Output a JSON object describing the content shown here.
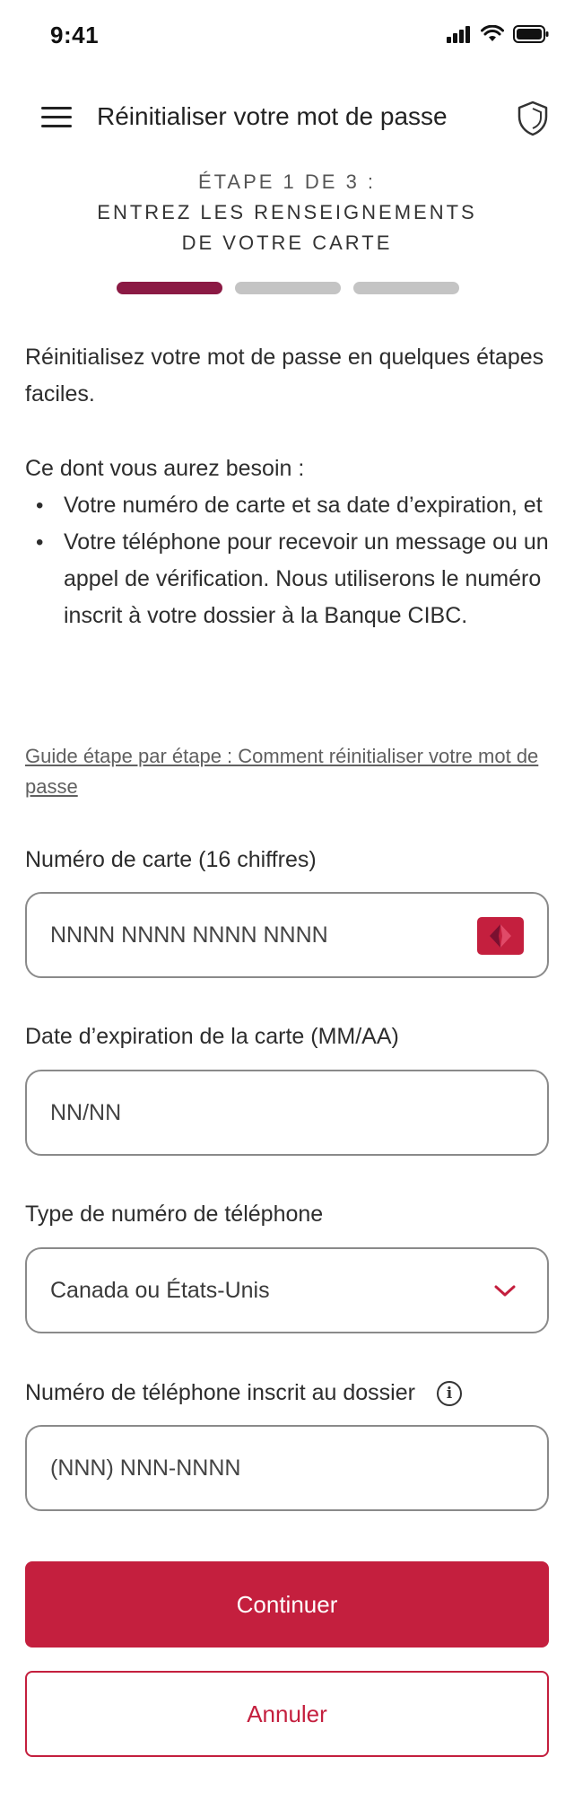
{
  "status_bar": {
    "time": "9:41"
  },
  "header": {
    "title": "Réinitialiser votre mot de passe"
  },
  "step": {
    "line1": "ÉTAPE 1 DE 3 :",
    "line2": "ENTREZ LES RENSEIGNEMENTS",
    "line3": "DE VOTRE CARTE",
    "current": 1,
    "total": 3
  },
  "intro": "Réinitialisez votre mot de passe en quelques étapes faciles.",
  "needs": {
    "title": "Ce dont vous aurez besoin :",
    "items": [
      "Votre numéro de carte et sa date d’expiration, et",
      "Votre téléphone pour recevoir un message ou un appel de vérification. Nous utiliserons le numéro inscrit à votre dossier à la Banque CIBC."
    ]
  },
  "guide_link": "Guide étape par étape : Comment réinitialiser votre mot de passe",
  "form": {
    "card_number": {
      "label": "Numéro de carte (16 chiffres)",
      "placeholder": "NNNN NNNN NNNN NNNN",
      "value": ""
    },
    "expiry": {
      "label": "Date d’expiration de la carte (MM/AA)",
      "placeholder": "NN/NN",
      "value": ""
    },
    "phone_type": {
      "label": "Type de numéro de téléphone",
      "selected": "Canada ou États-Unis"
    },
    "phone_number": {
      "label": "Numéro de téléphone inscrit au dossier",
      "placeholder": "(NNN) NNN-NNNN",
      "value": ""
    }
  },
  "buttons": {
    "continue": "Continuer",
    "cancel": "Annuler"
  },
  "colors": {
    "brand_red": "#c41f3e",
    "progress_active": "#8b1a44",
    "progress_inactive": "#c4c4c4"
  }
}
